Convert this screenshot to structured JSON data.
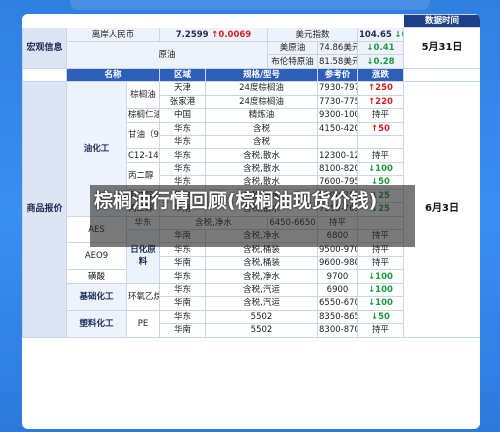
{
  "header": {
    "data_time_label": "数据时间",
    "section1": "宏观信息",
    "rmb_label": "离岸人民币",
    "rmb_value": "7.2599",
    "rmb_change": "↑0.0069",
    "usd_label": "美元指数",
    "usd_value": "104.65",
    "usd_change": "↓0.12",
    "crude_group": "原油",
    "us_crude": "美原油",
    "us_crude_val": "74.86美元/桶",
    "us_crude_chg": "↓0.41",
    "brent": "布伦特原油",
    "brent_val": "81.58美元/桶",
    "brent_chg": "↓0.28",
    "date1": "5月31日"
  },
  "columns": {
    "name": "名称",
    "region": "区域",
    "spec": "规格/型号",
    "ref_price": "参考价",
    "change": "涨跌",
    "data_time": "数据时间"
  },
  "section2": "商品报价",
  "date2": "6月3日",
  "rows": [
    {
      "group": "",
      "name": "棕榈油",
      "region": "天津",
      "spec": "24度棕榈油",
      "price": "7930-7970元/吨",
      "chg": "↑250",
      "dir": "up"
    },
    {
      "group": "",
      "name": "",
      "region": "张家港",
      "spec": "24度棕榈油",
      "price": "7730-7750元/吨",
      "chg": "↑220",
      "dir": "up"
    },
    {
      "group": "",
      "name": "棕榈仁油",
      "region": "中国",
      "spec": "精炼油",
      "price": "9300-10000元/吨",
      "chg": "持平",
      "dir": "flat"
    },
    {
      "group": "",
      "name": "甘油（99.5%）",
      "region": "华东",
      "spec": "含税",
      "price": "4150-4200",
      "chg": "↑50",
      "dir": "up"
    },
    {
      "group": "油化工",
      "name": "",
      "region": "华东",
      "spec": "含税",
      "price": "",
      "chg": "",
      "dir": "flat"
    },
    {
      "group": "",
      "name": "C12-14醇",
      "region": "华东",
      "spec": "含税,散水",
      "price": "12300-12500",
      "chg": "持平",
      "dir": "flat"
    },
    {
      "group": "",
      "name": "",
      "region": "华东",
      "spec": "含税,散水",
      "price": "8100-8200",
      "chg": "↓100",
      "dir": "down"
    },
    {
      "group": "",
      "name": "丙二醇（进口）",
      "region": "华东",
      "spec": "含税,散水",
      "price": "7600-7950",
      "chg": "↓50",
      "dir": "down"
    },
    {
      "group": "",
      "name": "",
      "region": "华东",
      "spec": "含税,散水",
      "price": "7500-7550",
      "chg": "↓25",
      "dir": "down"
    },
    {
      "group": "",
      "name": "丙二醇（国产）",
      "region": "华南",
      "spec": "含税,散水",
      "price": "7550-7650",
      "chg": "↓25",
      "dir": "down"
    },
    {
      "group": "",
      "name": "",
      "region": "华东",
      "spec": "含税,净水",
      "price": "6450-6650",
      "chg": "持平",
      "dir": "flat"
    },
    {
      "group": "日化原料",
      "name": "AES",
      "region": "华南",
      "spec": "含税,净水",
      "price": "6800",
      "chg": "持平",
      "dir": "flat"
    },
    {
      "group": "",
      "name": "",
      "region": "华东",
      "spec": "含税,桶装",
      "price": "9500-9700",
      "chg": "持平",
      "dir": "flat"
    },
    {
      "group": "",
      "name": "AEO9",
      "region": "华南",
      "spec": "含税,桶装",
      "price": "9600-9800",
      "chg": "持平",
      "dir": "flat"
    },
    {
      "group": "",
      "name": "磺酸",
      "region": "华东",
      "spec": "含税,净水",
      "price": "9700",
      "chg": "↓100",
      "dir": "down"
    },
    {
      "group": "基础化工",
      "name": "环氧乙烷",
      "region": "华东",
      "spec": "含税,汽运",
      "price": "6900",
      "chg": "↓100",
      "dir": "down"
    },
    {
      "group": "",
      "name": "",
      "region": "华南",
      "spec": "含税,汽运",
      "price": "6550-6700",
      "chg": "↓100",
      "dir": "down"
    },
    {
      "group": "塑料化工",
      "name": "PE",
      "region": "华东",
      "spec": "5502",
      "price": "8350-8650",
      "chg": "↓50",
      "dir": "down"
    },
    {
      "group": "",
      "name": "",
      "region": "华南",
      "spec": "5502",
      "price": "8300-8700",
      "chg": "持平",
      "dir": "flat"
    }
  ],
  "overlay_title": "棕榈油行情回顾(棕榈油现货价钱)"
}
